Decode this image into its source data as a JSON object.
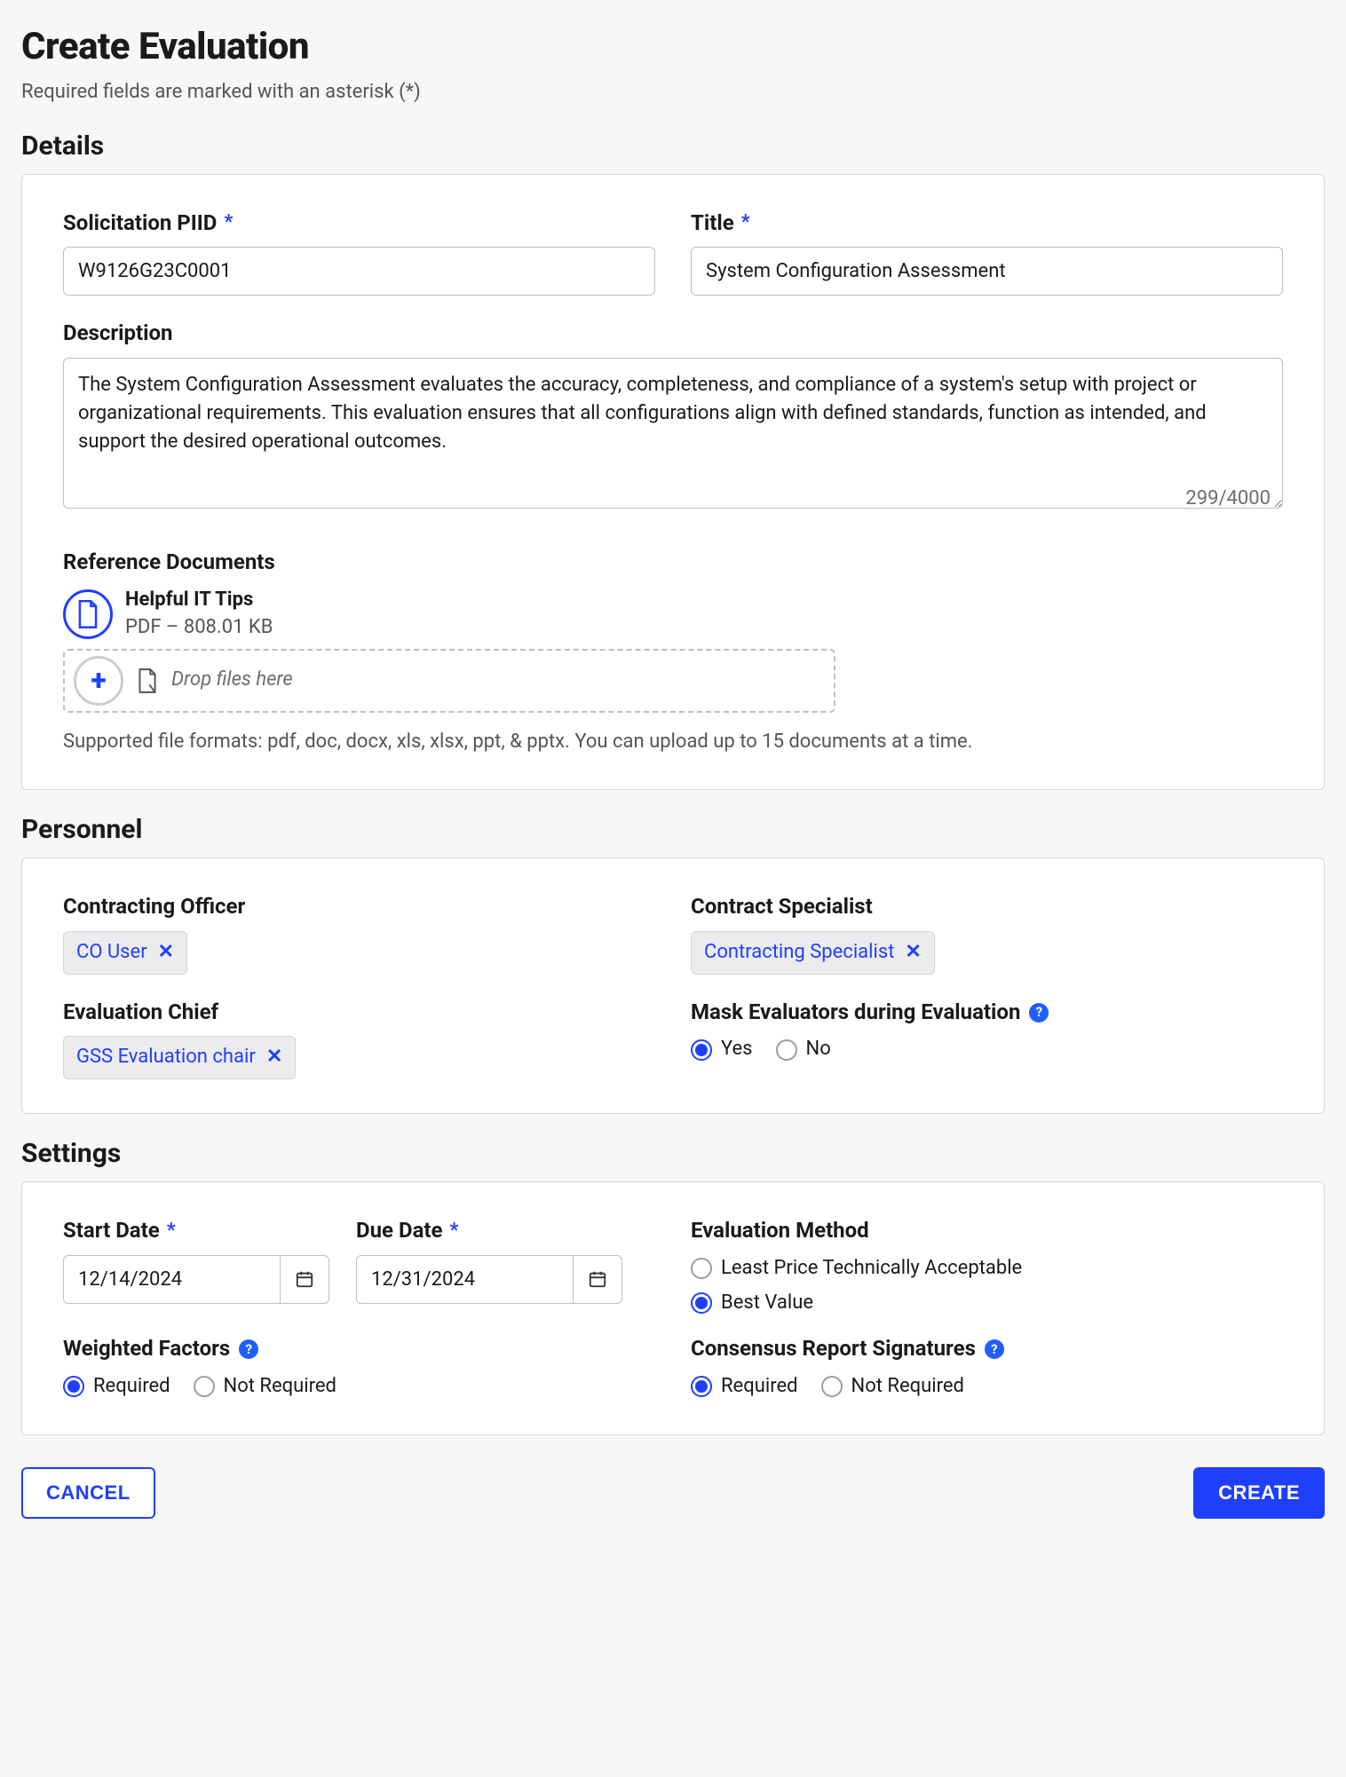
{
  "header": {
    "title": "Create Evaluation",
    "subtitle": "Required fields are marked with an asterisk (*)"
  },
  "sections": {
    "details": "Details",
    "personnel": "Personnel",
    "settings": "Settings"
  },
  "details": {
    "piid_label": "Solicitation PIID",
    "piid_value": "W9126G23C0001",
    "title_label": "Title",
    "title_value": "System Configuration Assessment",
    "description_label": "Description",
    "description_value": "The System Configuration Assessment evaluates the accuracy, completeness, and compliance of a system's setup with project or organizational requirements. This evaluation ensures that all configurations align with defined standards, function as intended, and support the desired operational outcomes.",
    "description_count": "299/4000",
    "ref_docs_label": "Reference Documents",
    "doc": {
      "name": "Helpful IT Tips",
      "meta": "PDF – 808.01 KB"
    },
    "dropzone_text": "Drop files here",
    "supported_hint": "Supported file formats: pdf, doc, docx, xls, xlsx, ppt, & pptx. You can upload up to 15 documents at a time."
  },
  "personnel": {
    "co_label": "Contracting Officer",
    "co_chip": "CO User",
    "cs_label": "Contract Specialist",
    "cs_chip": "Contracting Specialist",
    "chief_label": "Evaluation Chief",
    "chief_chip": "GSS Evaluation chair",
    "mask_label": "Mask Evaluators during Evaluation",
    "mask_options": {
      "yes": "Yes",
      "no": "No"
    },
    "mask_selected": "yes"
  },
  "settings": {
    "start_label": "Start Date",
    "start_value": "12/14/2024",
    "due_label": "Due Date",
    "due_value": "12/31/2024",
    "method_label": "Evaluation Method",
    "method_options": {
      "lpta": "Least Price Technically Acceptable",
      "best": "Best Value"
    },
    "method_selected": "best",
    "weighted_label": "Weighted Factors",
    "weighted_options": {
      "req": "Required",
      "notreq": "Not Required"
    },
    "weighted_selected": "req",
    "sig_label": "Consensus Report Signatures",
    "sig_options": {
      "req": "Required",
      "notreq": "Not Required"
    },
    "sig_selected": "req"
  },
  "buttons": {
    "cancel": "CANCEL",
    "create": "CREATE"
  }
}
